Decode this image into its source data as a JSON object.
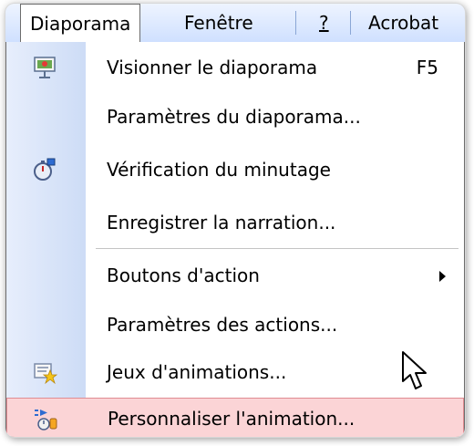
{
  "menubar": {
    "items": [
      {
        "label": "Diaporama"
      },
      {
        "label": "Fenêtre"
      },
      {
        "label": "?"
      },
      {
        "label": "Acrobat"
      }
    ]
  },
  "menu": {
    "items": [
      {
        "label": "Visionner le diaporama",
        "shortcut": "F5",
        "icon": "slideshow-screen-icon"
      },
      {
        "label": "Paramètres du diaporama...",
        "icon": null
      },
      {
        "label": "Vérification du minutage",
        "icon": "stopwatch-icon"
      },
      {
        "label": "Enregistrer la narration...",
        "icon": null
      },
      {
        "label": "Boutons d'action",
        "submenu": true,
        "icon": null
      },
      {
        "label": "Paramètres des actions...",
        "icon": null
      },
      {
        "label": "Jeux d'animations...",
        "icon": "animation-schemes-icon"
      },
      {
        "label": "Personnaliser l'animation...",
        "icon": "custom-animation-icon",
        "highlighted": true
      }
    ]
  },
  "colors": {
    "highlight_bg": "#fbd4d6",
    "highlight_border": "#e08c92",
    "icon_column": "#cddcf6",
    "menubar": "#cfe0ff"
  }
}
